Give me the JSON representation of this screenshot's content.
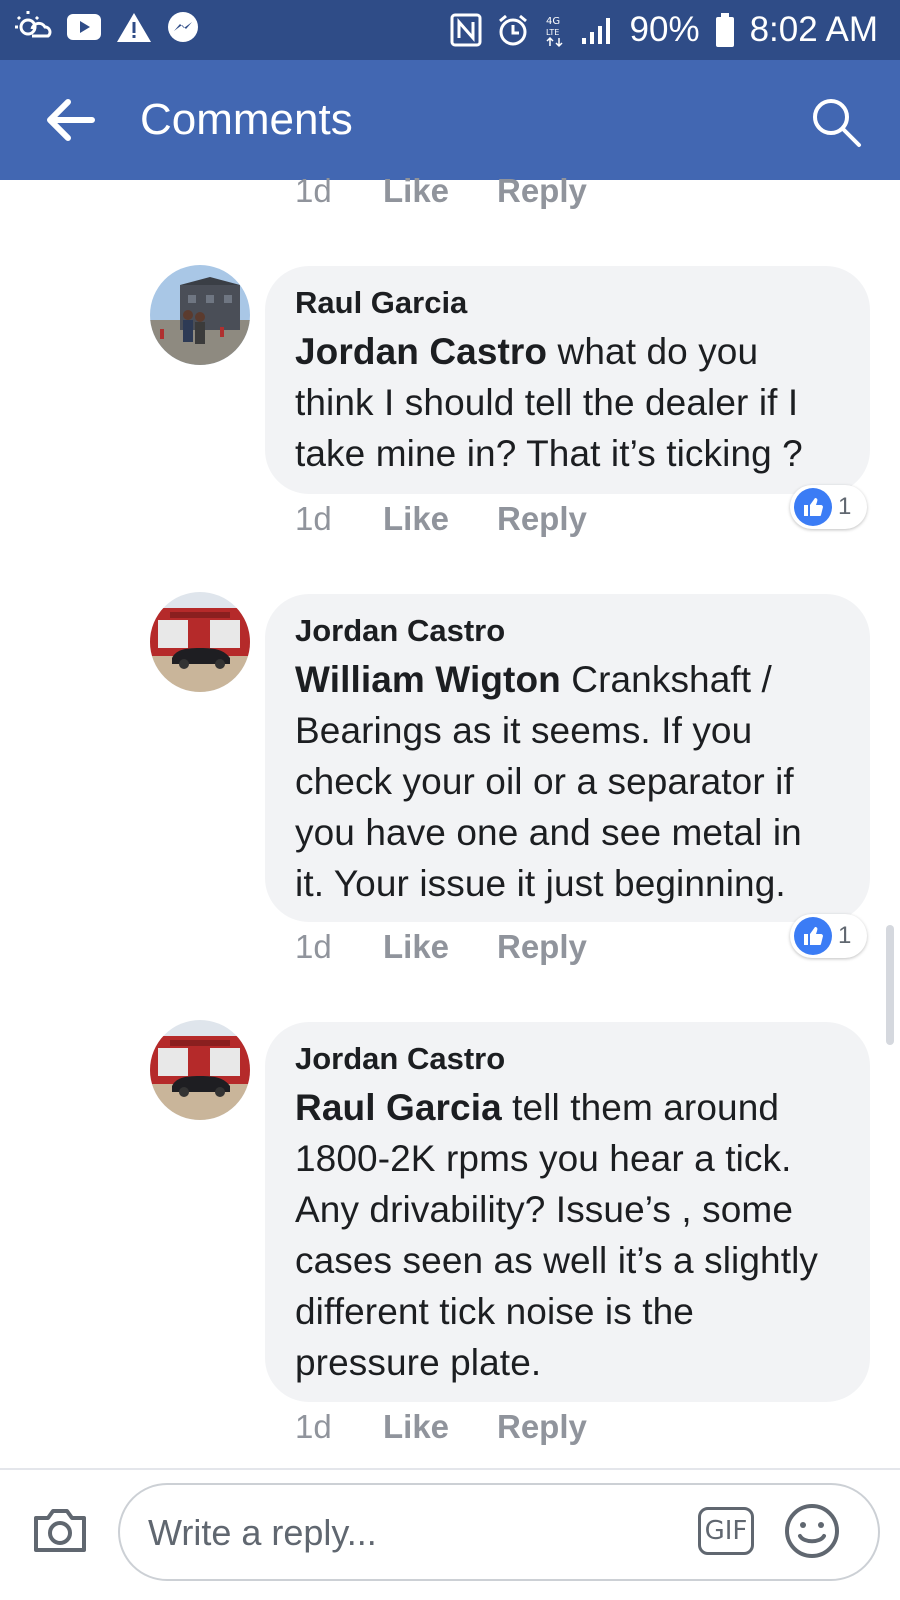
{
  "status_bar": {
    "battery": "90%",
    "time": "8:02 AM",
    "network": "4G LTE"
  },
  "app_bar": {
    "title": "Comments"
  },
  "top_meta": {
    "time": "1d",
    "like": "Like",
    "reply": "Reply"
  },
  "comments": [
    {
      "author": "Raul Garcia",
      "mention": "Jordan Castro",
      "text": " what do you think I should tell the dealer if I take mine in? That it’s ticking ?",
      "time": "1d",
      "like": "Like",
      "reply": "Reply",
      "reaction_count": "1"
    },
    {
      "author": "Jordan Castro",
      "mention": "William Wigton",
      "text": "  Crankshaft / Bearings as it seems. If you check your oil or a separator if you have one and see metal in it. Your issue it just beginning.",
      "time": "1d",
      "like": "Like",
      "reply": "Reply",
      "reaction_count": "1"
    },
    {
      "author": "Jordan Castro",
      "mention": "Raul Garcia",
      "text": " tell them around 1800-2K rpms you hear a tick. Any drivability? Issue’s , some cases seen as well it’s a slightly different tick noise is the pressure plate.",
      "time": "1d",
      "like": "Like",
      "reply": "Reply"
    }
  ],
  "composer": {
    "placeholder": "Write a reply...",
    "gif_label": "GIF"
  },
  "colors": {
    "status_bar": "#2f4c87",
    "app_bar": "#4267b2",
    "bubble": "#f2f3f5",
    "meta_text": "#90949c",
    "like_badge": "#3b7cf5"
  }
}
